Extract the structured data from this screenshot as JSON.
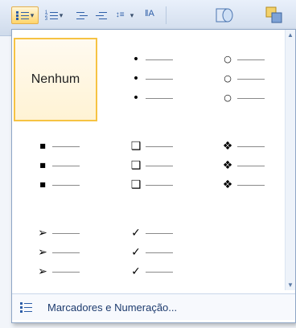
{
  "toolbar": {
    "icons": [
      "bullets-icon",
      "numbering-icon",
      "multilevel-list-icon",
      "decrease-indent-icon",
      "increase-indent-icon",
      "line-spacing-icon",
      "text-direction-icon",
      "shape-icon",
      "arrange-icon"
    ]
  },
  "gallery": {
    "none_label": "Nenhum",
    "items": [
      {
        "kind": "none",
        "selected": true
      },
      {
        "kind": "bullet",
        "glyph": "•"
      },
      {
        "kind": "bullet",
        "glyph": "○"
      },
      {
        "kind": "bullet",
        "glyph": "■"
      },
      {
        "kind": "bullet",
        "glyph": "❑"
      },
      {
        "kind": "bullet",
        "glyph": "❖"
      },
      {
        "kind": "bullet",
        "glyph": "➢"
      },
      {
        "kind": "bullet",
        "glyph": "✓"
      }
    ]
  },
  "footer": {
    "label": "Marcadores e Numeração..."
  },
  "colors": {
    "selected_border": "#f6c343",
    "ribbon": "#cfdbeb",
    "popup_border": "#8ea6c6",
    "footer_text": "#1d3b6e"
  }
}
